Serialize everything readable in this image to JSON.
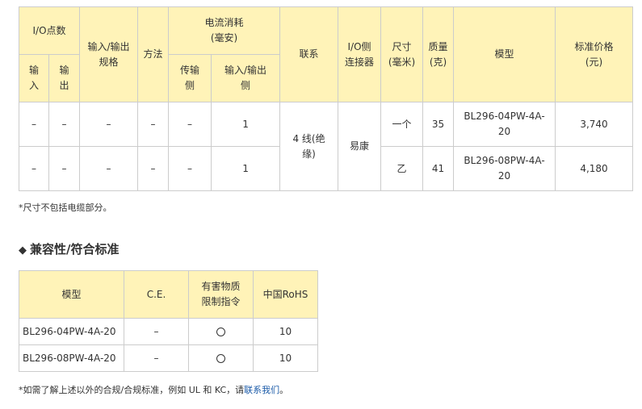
{
  "spec_table": {
    "headers": {
      "io_points": "I/O点数",
      "input": "输入",
      "output": "输出",
      "io_spec": "输入/输出规格",
      "method": "方法",
      "current_consumption": "电流消耗\n(毫安)",
      "transmit_side": "传输侧",
      "io_side": "输入/输出侧",
      "link": "联系",
      "io_connector": "I/O侧连接器",
      "size": "尺寸\n(毫米)",
      "mass": "质量\n(克)",
      "model": "模型",
      "price": "标准价格\n(元)"
    },
    "rows": [
      {
        "input": "–",
        "output": "–",
        "io_spec": "–",
        "method": "–",
        "transmit": "–",
        "io_side": "1",
        "size": "一个",
        "mass": "35",
        "model": "BL296-04PW-4A-\n20",
        "price": "3,740"
      },
      {
        "input": "–",
        "output": "–",
        "io_spec": "–",
        "method": "–",
        "transmit": "–",
        "io_side": "1",
        "size": "乙",
        "mass": "41",
        "model": "BL296-08PW-4A-\n20",
        "price": "4,180"
      }
    ],
    "link_value": "4 线(绝\n缘)",
    "connector_value": "易康",
    "note": "*尺寸不包括电缆部分。"
  },
  "compliance": {
    "heading": "兼容性/符合标准",
    "icon": "diamond-icon",
    "headers": {
      "model": "模型",
      "ce": "C.E.",
      "hazard": "有害物质\n限制指令",
      "rohs": "中国RoHS"
    },
    "rows": [
      {
        "model": "BL296-04PW-4A-20",
        "ce": "–",
        "hazard": "〇",
        "rohs": "10"
      },
      {
        "model": "BL296-08PW-4A-20",
        "ce": "–",
        "hazard": "〇",
        "rohs": "10"
      }
    ],
    "note_prefix": "*如需了解上述以外的合规/合规标准，例如 UL 和 KC，请",
    "note_link": "联系我们",
    "note_suffix": "。"
  }
}
